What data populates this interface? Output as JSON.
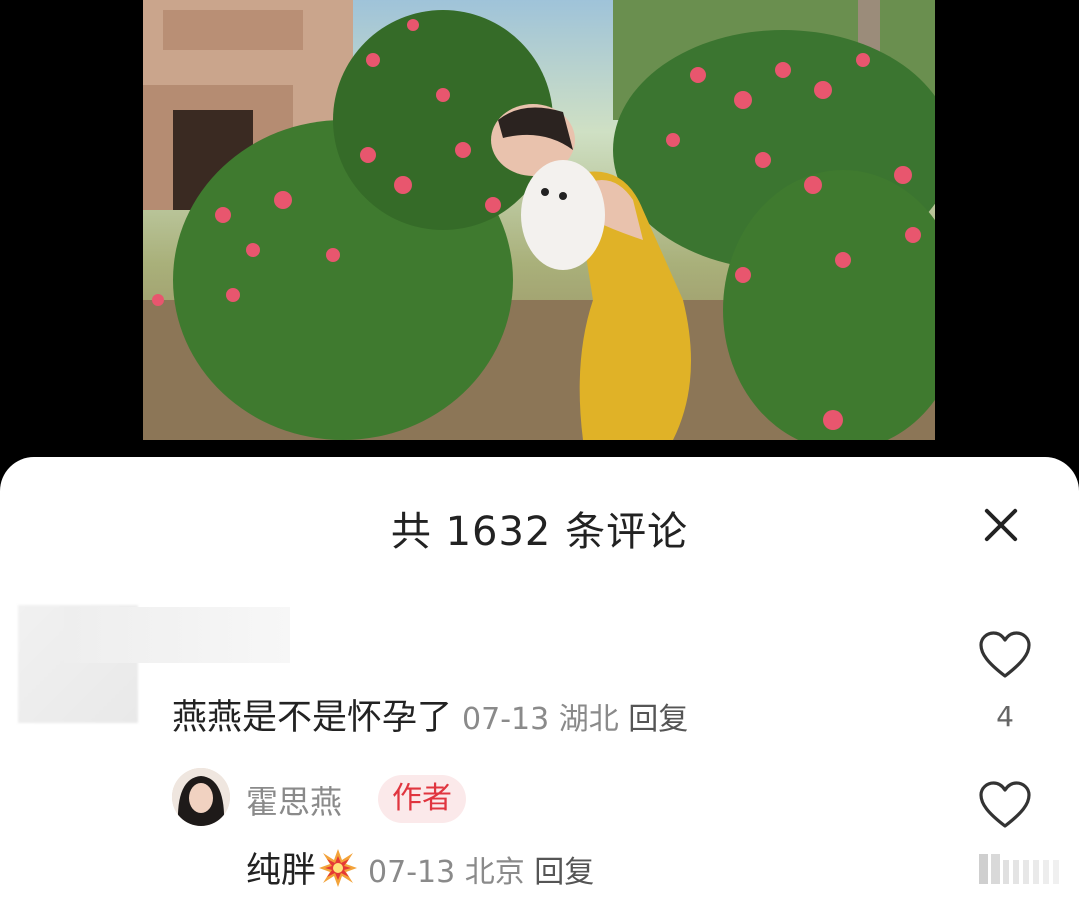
{
  "sheet": {
    "title": "共 1632 条评论",
    "close_icon": "close-icon"
  },
  "comments": [
    {
      "text": "燕燕是不是怀孕了",
      "date": "07-13",
      "location": "湖北",
      "reply_label": "回复",
      "likes": "4"
    }
  ],
  "replies": [
    {
      "username": "霍思燕",
      "badge": "作者",
      "text": "纯胖",
      "emoji": "collision-emoji-icon",
      "date": "07-13",
      "location": "北京",
      "reply_label": "回复"
    }
  ],
  "colors": {
    "badge_bg": "#fbe9ea",
    "badge_text": "#e0353f",
    "meta": "#8a8a8a"
  }
}
